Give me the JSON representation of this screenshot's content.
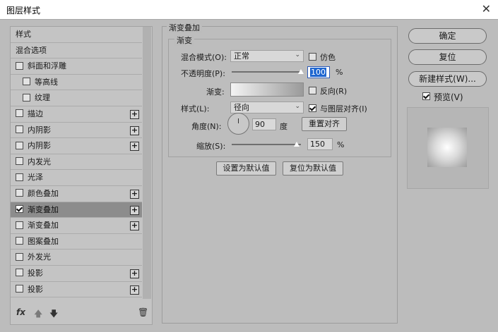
{
  "window": {
    "title": "图层样式"
  },
  "styles_list": [
    {
      "label": "样式",
      "checkbox": false,
      "plus": false,
      "sub": false,
      "checked": false,
      "selected": false
    },
    {
      "label": "混合选项",
      "checkbox": false,
      "plus": false,
      "sub": false,
      "checked": false,
      "selected": false
    },
    {
      "label": "斜面和浮雕",
      "checkbox": true,
      "plus": false,
      "sub": false,
      "checked": false,
      "selected": false
    },
    {
      "label": "等高线",
      "checkbox": true,
      "plus": false,
      "sub": true,
      "checked": false,
      "selected": false
    },
    {
      "label": "纹理",
      "checkbox": true,
      "plus": false,
      "sub": true,
      "checked": false,
      "selected": false
    },
    {
      "label": "描边",
      "checkbox": true,
      "plus": true,
      "sub": false,
      "checked": false,
      "selected": false
    },
    {
      "label": "内阴影",
      "checkbox": true,
      "plus": true,
      "sub": false,
      "checked": false,
      "selected": false
    },
    {
      "label": "内阴影",
      "checkbox": true,
      "plus": true,
      "sub": false,
      "checked": false,
      "selected": false
    },
    {
      "label": "内发光",
      "checkbox": true,
      "plus": false,
      "sub": false,
      "checked": false,
      "selected": false
    },
    {
      "label": "光泽",
      "checkbox": true,
      "plus": false,
      "sub": false,
      "checked": false,
      "selected": false
    },
    {
      "label": "颜色叠加",
      "checkbox": true,
      "plus": true,
      "sub": false,
      "checked": false,
      "selected": false
    },
    {
      "label": "渐变叠加",
      "checkbox": true,
      "plus": true,
      "sub": false,
      "checked": true,
      "selected": true
    },
    {
      "label": "渐变叠加",
      "checkbox": true,
      "plus": true,
      "sub": false,
      "checked": false,
      "selected": false
    },
    {
      "label": "图案叠加",
      "checkbox": true,
      "plus": false,
      "sub": false,
      "checked": false,
      "selected": false
    },
    {
      "label": "外发光",
      "checkbox": true,
      "plus": false,
      "sub": false,
      "checked": false,
      "selected": false
    },
    {
      "label": "投影",
      "checkbox": true,
      "plus": true,
      "sub": false,
      "checked": false,
      "selected": false
    },
    {
      "label": "投影",
      "checkbox": true,
      "plus": true,
      "sub": false,
      "checked": false,
      "selected": false
    }
  ],
  "list_footer": {
    "fx": "fx",
    "up_icon": "arrow-up-icon",
    "down_icon": "arrow-down-icon",
    "trash_icon": "trash-icon"
  },
  "panel": {
    "section_title": "渐变叠加",
    "group_title": "渐变",
    "blend_mode_label": "混合模式(O):",
    "blend_mode_value": "正常",
    "dither_label": "仿色",
    "opacity_label": "不透明度(P):",
    "opacity_value": "100",
    "opacity_unit": "%",
    "opacity_level": 1.0,
    "gradient_label": "渐变:",
    "reverse_label": "反向(R)",
    "style_label": "样式(L):",
    "style_value": "径向",
    "align_label": "与图层对齐(I)",
    "angle_label": "角度(N):",
    "angle_value": "90",
    "angle_unit": "度",
    "reset_align_button": "重置对齐",
    "scale_label": "缩放(S):",
    "scale_value": "150",
    "scale_unit": "%",
    "make_default_button": "设置为默认值",
    "reset_default_button": "复位为默认值"
  },
  "right": {
    "ok_button": "确定",
    "reset_button": "复位",
    "new_style_button": "新建样式(W)...",
    "preview_label": "预览(V)"
  },
  "colors": {
    "dialog_bg": "#bcbcbc",
    "selected_row": "#8c8c8c",
    "highlight": "#1e66d0"
  }
}
